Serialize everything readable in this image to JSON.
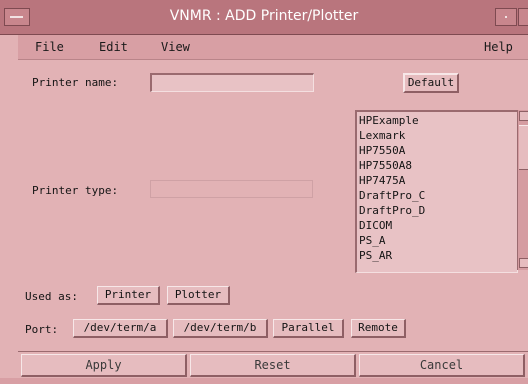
{
  "window": {
    "title": "VNMR : ADD  Printer/Plotter"
  },
  "menubar": {
    "items": [
      "File",
      "Edit",
      "View"
    ],
    "help": "Help"
  },
  "form": {
    "printer_name_label": "Printer name:",
    "printer_name_value": "",
    "default_button": "Default",
    "printer_type_label": "Printer type:",
    "printer_type_value": "",
    "printer_types": [
      "HPExample",
      "Lexmark",
      "HP7550A",
      "HP7550A8",
      "HP7475A",
      "DraftPro_C",
      "DraftPro_D",
      "DICOM",
      "PS_A",
      "PS_AR"
    ],
    "used_as_label": "Used as:",
    "used_as_options": [
      "Printer",
      "Plotter"
    ],
    "port_label": "Port:",
    "port_options": [
      "/dev/term/a",
      "/dev/term/b",
      "Parallel",
      "Remote"
    ]
  },
  "actions": {
    "apply": "Apply",
    "reset": "Reset",
    "cancel": "Cancel"
  },
  "colors": {
    "title_bar": "#b9757d",
    "background": "#e2b2b5",
    "menubar": "#d89fa4"
  }
}
